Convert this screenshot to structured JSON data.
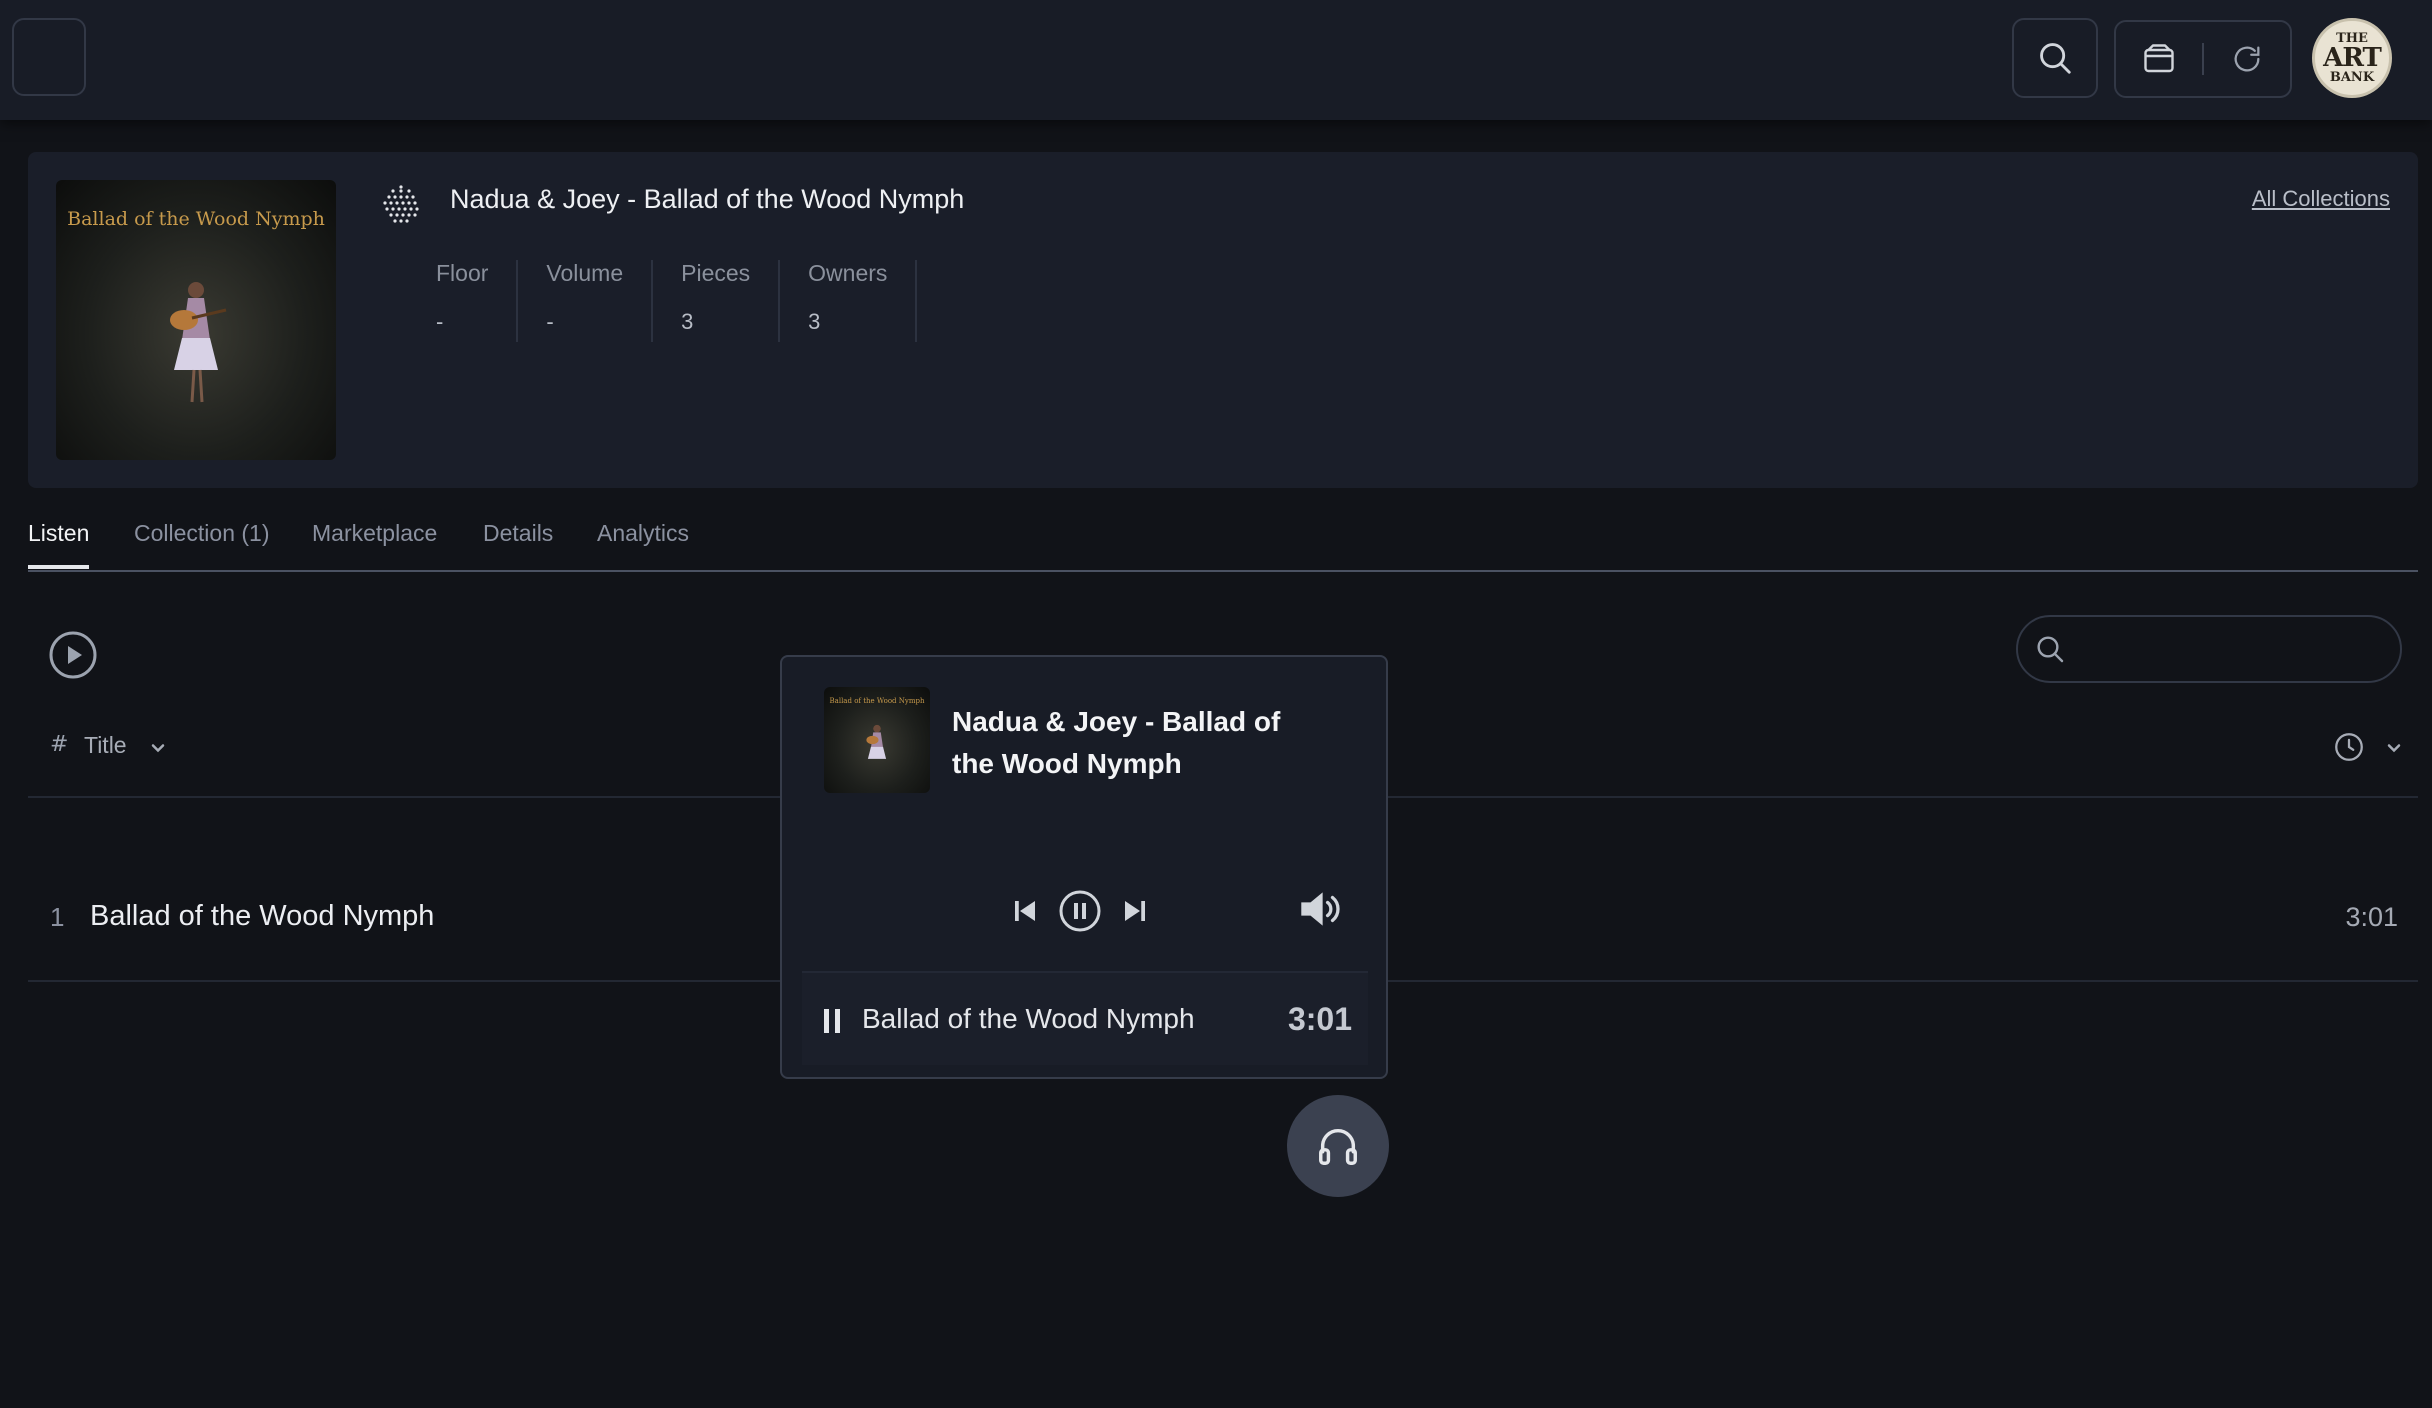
{
  "topbar": {
    "avatar": {
      "line1": "THE",
      "line2": "ART",
      "line3": "BANK"
    }
  },
  "collection": {
    "cover_title": "Ballad of the Wood Nymph",
    "title": "Nadua & Joey - Ballad of the Wood Nymph",
    "all_collections_label": "All Collections",
    "stats": [
      {
        "label": "Floor",
        "value": "-"
      },
      {
        "label": "Volume",
        "value": "-"
      },
      {
        "label": "Pieces",
        "value": "3"
      },
      {
        "label": "Owners",
        "value": "3"
      }
    ]
  },
  "tabs": [
    {
      "label": "Listen",
      "active": true
    },
    {
      "label": "Collection (1)",
      "active": false
    },
    {
      "label": "Marketplace",
      "active": false
    },
    {
      "label": "Details",
      "active": false
    },
    {
      "label": "Analytics",
      "active": false
    }
  ],
  "track_list": {
    "search_placeholder": "",
    "columns": {
      "number": "#",
      "title": "Title"
    },
    "tracks": [
      {
        "number": "1",
        "title": "Ballad of the Wood Nymph",
        "duration": "3:01"
      }
    ]
  },
  "player": {
    "title": "Nadua & Joey - Ballad of the Wood Nymph",
    "now_playing": {
      "title": "Ballad of the Wood Nymph",
      "duration": "3:01"
    }
  },
  "colors": {
    "background": "#111318",
    "panel": "#1a1e29",
    "border": "#323846",
    "accent_text": "#f3f4f6"
  }
}
